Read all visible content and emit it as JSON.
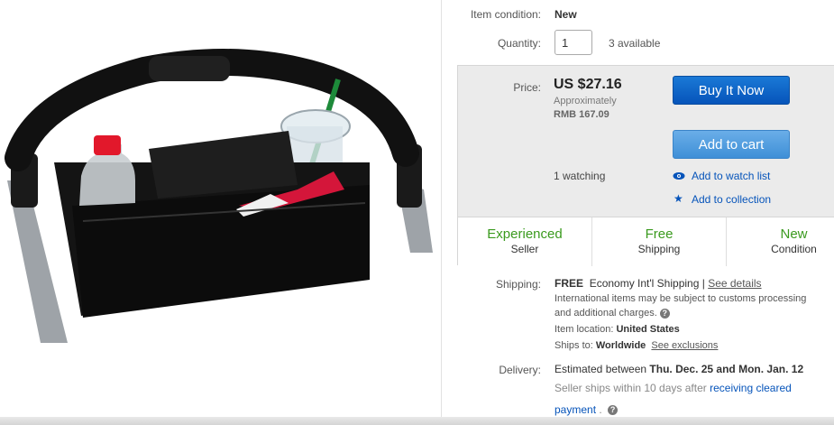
{
  "item": {
    "condition_label": "Item condition:",
    "condition_value": "New",
    "quantity_label": "Quantity:",
    "quantity_value": "1",
    "available": "3 available"
  },
  "price": {
    "label": "Price:",
    "value": "US $27.16",
    "approx_label": "Approximately",
    "approx_value": "RMB 167.09",
    "watching": "1 watching"
  },
  "actions": {
    "buy_now": "Buy It Now",
    "add_to_cart": "Add to cart",
    "watch_list": "Add to watch list",
    "collection": "Add to collection"
  },
  "features": [
    {
      "title": "Experienced",
      "sub": "Seller"
    },
    {
      "title": "Free",
      "sub": "Shipping"
    },
    {
      "title": "New",
      "sub": "Condition"
    }
  ],
  "shipping": {
    "label": "Shipping:",
    "free": "FREE",
    "method": "Economy Int'l Shipping |",
    "details_link": "See details",
    "note_line1": "International items may be subject to customs processing",
    "note_line2": "and additional charges.",
    "location_label": "Item location:",
    "location_value": "United States",
    "ships_to_label": "Ships to:",
    "ships_to_value": "Worldwide",
    "exclusions_link": "See exclusions"
  },
  "delivery": {
    "label": "Delivery:",
    "estimated": "Estimated between",
    "range": "Thu. Dec. 25 and Mon. Jan. 12",
    "note": "Seller ships within 10 days after",
    "note_link": "receiving cleared",
    "note_link2": "payment",
    "note_end": "."
  },
  "colors": {
    "buy_button": "#0654ba",
    "cart_button": "#3f8fd7",
    "feature_green": "#3a9a1e",
    "link_blue": "#0654ba"
  }
}
